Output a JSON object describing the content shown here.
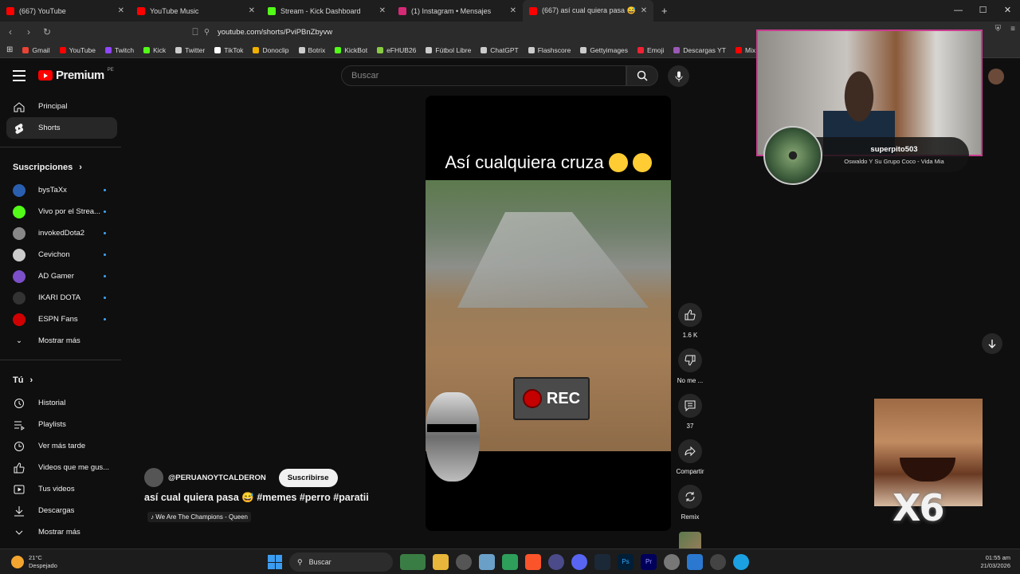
{
  "browser": {
    "tabs": [
      {
        "label": "(667) YouTube",
        "color": "#ff0000"
      },
      {
        "label": "YouTube Music",
        "color": "#ff0000"
      },
      {
        "label": "Stream - Kick Dashboard",
        "color": "#53fc18"
      },
      {
        "label": "(1) Instagram • Mensajes",
        "color": "#d62976"
      },
      {
        "label": "(667) así cual quiera pasa 😅",
        "color": "#ff0000"
      }
    ],
    "url": "youtube.com/shorts/PviPBnZbyvw",
    "bookmarks": [
      {
        "label": "Gmail",
        "color": "#ea4335"
      },
      {
        "label": "YouTube",
        "color": "#ff0000"
      },
      {
        "label": "Twitch",
        "color": "#9146ff"
      },
      {
        "label": "Kick",
        "color": "#53fc18"
      },
      {
        "label": "Twitter",
        "color": "#cccccc"
      },
      {
        "label": "TikTok",
        "color": "#ffffff"
      },
      {
        "label": "Donoclip",
        "color": "#f0b000"
      },
      {
        "label": "Botrix",
        "color": "#cccccc"
      },
      {
        "label": "KickBot",
        "color": "#53fc18"
      },
      {
        "label": "eFHUB26",
        "color": "#88cc44"
      },
      {
        "label": "Fútbol Libre",
        "color": "#cccccc"
      },
      {
        "label": "ChatGPT",
        "color": "#cccccc"
      },
      {
        "label": "Flashscore",
        "color": "#cccccc"
      },
      {
        "label": "Gettyimages",
        "color": "#cccccc"
      },
      {
        "label": "Emoji",
        "color": "#e23"
      },
      {
        "label": "Descargas YT",
        "color": "#9b59b6"
      },
      {
        "label": "Mix N",
        "color": "#ff0000"
      }
    ]
  },
  "header": {
    "logo_text": "Premium",
    "region": "PE",
    "search_placeholder": "Buscar"
  },
  "sidebar": {
    "main": [
      {
        "label": "Principal",
        "icon": "home-icon"
      },
      {
        "label": "Shorts",
        "icon": "shorts-icon",
        "active": true
      }
    ],
    "subs_title": "Suscripciones",
    "subscriptions": [
      {
        "label": "bysTaXx",
        "color": "#2a5fb0"
      },
      {
        "label": "Vivo por el Strea...",
        "color": "#53fc18"
      },
      {
        "label": "invokedDota2",
        "color": "#888888"
      },
      {
        "label": "Cevichon",
        "color": "#cccccc"
      },
      {
        "label": "AD Gamer",
        "color": "#7b4fc9"
      },
      {
        "label": "IKARI DOTA",
        "color": "#333333"
      },
      {
        "label": "ESPN Fans",
        "color": "#d00000"
      }
    ],
    "subs_more": "Mostrar más",
    "you_title": "Tú",
    "you_items": [
      {
        "label": "Historial",
        "icon": "history-icon"
      },
      {
        "label": "Playlists",
        "icon": "playlist-icon"
      },
      {
        "label": "Ver más tarde",
        "icon": "clock-icon"
      },
      {
        "label": "Videos que me gus...",
        "icon": "like-icon"
      },
      {
        "label": "Tus videos",
        "icon": "video-icon"
      },
      {
        "label": "Descargas",
        "icon": "download-icon"
      },
      {
        "label": "Mostrar más",
        "icon": "chevron-down-icon"
      }
    ]
  },
  "short": {
    "caption": "Así cualquiera cruza",
    "rec_label": "REC",
    "channel": "@PERUANOYTCALDERON",
    "subscribe": "Suscribirse",
    "title": "así cual quiera pasa 😅 #memes #perro #paratii",
    "music": "♪ We Are The Champions - Queen"
  },
  "actions": {
    "likes": "1.6 K",
    "dislike": "No me ...",
    "comments": "37",
    "share": "Compartir",
    "remix": "Remix"
  },
  "overlay": {
    "now_playing_user": "superpito503",
    "now_playing_song": "Oswaldo Y Su Grupo Coco - Vida Mia",
    "combo": "X6"
  },
  "taskbar": {
    "temp": "21°C",
    "weather": "Despejado",
    "search": "Buscar",
    "time": "01:55 am",
    "date": "21/03/2026"
  }
}
